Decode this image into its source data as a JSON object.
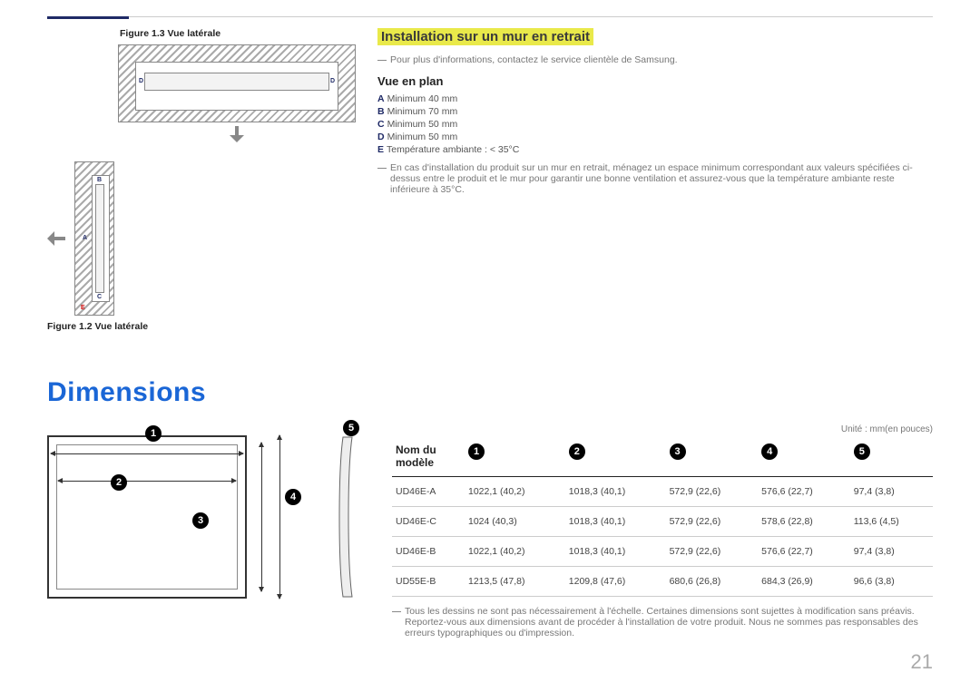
{
  "captions": {
    "fig13": "Figure 1.3 Vue latérale",
    "fig12": "Figure 1.2 Vue latérale"
  },
  "install": {
    "heading": "Installation sur un mur en retrait",
    "note": "Pour plus d'informations, contactez le service clientèle de Samsung.",
    "plan_heading": "Vue en plan",
    "specs": {
      "a": "Minimum 40 mm",
      "b": "Minimum 70 mm",
      "c": "Minimum 50 mm",
      "d": "Minimum 50 mm",
      "e": "Température ambiante : < 35°C"
    },
    "warn": "En cas d'installation du produit sur un mur en retrait, ménagez un espace minimum correspondant aux valeurs spécifiées ci-dessus entre le produit et le mur pour garantir une bonne ventilation et assurez-vous que la température ambiante reste inférieure à 35°C."
  },
  "dimensions": {
    "title": "Dimensions",
    "unit": "Unité : mm(en pouces)",
    "header_model": "Nom du modèle",
    "rows": [
      {
        "model": "UD46E-A",
        "c1": "1022,1 (40,2)",
        "c2": "1018,3 (40,1)",
        "c3": "572,9 (22,6)",
        "c4": "576,6 (22,7)",
        "c5": "97,4 (3,8)"
      },
      {
        "model": "UD46E-C",
        "c1": "1024 (40,3)",
        "c2": "1018,3 (40,1)",
        "c3": "572,9 (22,6)",
        "c4": "578,6 (22,8)",
        "c5": "113,6 (4,5)"
      },
      {
        "model": "UD46E-B",
        "c1": "1022,1 (40,2)",
        "c2": "1018,3 (40,1)",
        "c3": "572,9 (22,6)",
        "c4": "576,6 (22,7)",
        "c5": "97,4 (3,8)"
      },
      {
        "model": "UD55E-B",
        "c1": "1213,5 (47,8)",
        "c2": "1209,8 (47,6)",
        "c3": "680,6 (26,8)",
        "c4": "684,3 (26,9)",
        "c5": "96,6 (3,8)"
      }
    ],
    "note": "Tous les dessins ne sont pas nécessairement à l'échelle. Certaines dimensions sont sujettes à modification sans préavis. Reportez-vous aux dimensions avant de procéder à l'installation de votre produit. Nous ne sommes pas responsables des erreurs typographiques ou d'impression."
  },
  "labels": {
    "D": "D",
    "B": "B",
    "A": "A",
    "C": "C",
    "E": "E"
  },
  "callouts": {
    "n1": "1",
    "n2": "2",
    "n3": "3",
    "n4": "4",
    "n5": "5"
  },
  "page_number": "21"
}
